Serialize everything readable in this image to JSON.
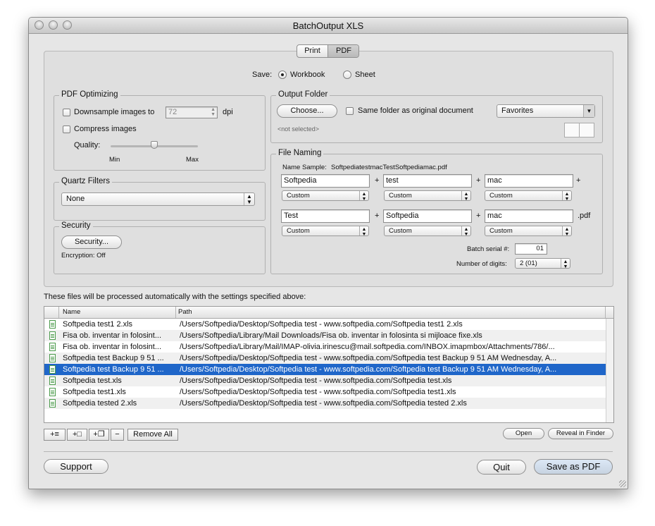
{
  "window": {
    "title": "BatchOutput XLS"
  },
  "segment": {
    "print": "Print",
    "pdf": "PDF",
    "selected": "PDF"
  },
  "save": {
    "label": "Save:",
    "workbook": "Workbook",
    "sheet": "Sheet",
    "selected": "Workbook"
  },
  "pdf_optimizing": {
    "legend": "PDF Optimizing",
    "downsample_label": "Downsample images to",
    "downsample_checked": false,
    "dpi_value": "72",
    "dpi_unit": "dpi",
    "compress_label": "Compress images",
    "compress_checked": false,
    "quality_label": "Quality:",
    "min_label": "Min",
    "max_label": "Max",
    "quality_level": 0.5
  },
  "quartz": {
    "legend": "Quartz Filters",
    "selected": "None"
  },
  "security": {
    "legend": "Security",
    "button": "Security...",
    "encryption": "Encryption: Off"
  },
  "output_folder": {
    "legend": "Output Folder",
    "choose_button": "Choose...",
    "same_folder_label": "Same folder as original document",
    "same_folder_checked": false,
    "favorites": "Favorites",
    "not_selected": "<not selected>"
  },
  "file_naming": {
    "legend": "File Naming",
    "sample_label": "Name Sample:",
    "sample_value": "SoftpediatestmacTestSoftpediamac.pdf",
    "row1": [
      {
        "value": "Softpedia",
        "popup": "Custom",
        "sep": "+"
      },
      {
        "value": "test",
        "popup": "Custom",
        "sep": "+"
      },
      {
        "value": "mac",
        "popup": "Custom",
        "sep": "+"
      }
    ],
    "row2": [
      {
        "value": "Test",
        "popup": "Custom",
        "sep": "+"
      },
      {
        "value": "Softpedia",
        "popup": "Custom",
        "sep": "+"
      },
      {
        "value": "mac",
        "popup": "Custom",
        "sep": ".pdf"
      }
    ],
    "batch_serial_label": "Batch serial #:",
    "batch_serial_value": "01",
    "digits_label": "Number of digits:",
    "digits_value": "2 (01)"
  },
  "files": {
    "caption": "These files will be processed automatically with the settings specified above:",
    "col_name": "Name",
    "col_path": "Path",
    "rows": [
      {
        "name": "Softpedia test1 2.xls",
        "path": "/Users/Softpedia/Desktop/Softpedia test - www.softpedia.com/Softpedia test1 2.xls",
        "selected": false
      },
      {
        "name": "Fisa ob. inventar in folosint...",
        "path": "/Users/Softpedia/Library/Mail Downloads/Fisa ob. inventar in folosinta si mijloace fixe.xls",
        "selected": false
      },
      {
        "name": "Fisa ob. inventar in folosint...",
        "path": "/Users/Softpedia/Library/Mail/IMAP-olivia.irinescu@mail.softpedia.com/INBOX.imapmbox/Attachments/786/...",
        "selected": false
      },
      {
        "name": "Softpedia test Backup 9 51 ...",
        "path": "/Users/Softpedia/Desktop/Softpedia test - www.softpedia.com/Softpedia test Backup 9 51 AM Wednesday, A...",
        "selected": false
      },
      {
        "name": "Softpedia test Backup 9 51 ...",
        "path": "/Users/Softpedia/Desktop/Softpedia test - www.softpedia.com/Softpedia test Backup 9 51 AM Wednesday, A...",
        "selected": true
      },
      {
        "name": "Softpedia test.xls",
        "path": "/Users/Softpedia/Desktop/Softpedia test - www.softpedia.com/Softpedia test.xls",
        "selected": false
      },
      {
        "name": "Softpedia test1.xls",
        "path": "/Users/Softpedia/Desktop/Softpedia test - www.softpedia.com/Softpedia test1.xls",
        "selected": false
      },
      {
        "name": "Softpedia tested 2.xls",
        "path": "/Users/Softpedia/Desktop/Softpedia test - www.softpedia.com/Softpedia tested 2.xls",
        "selected": false
      }
    ]
  },
  "list_tools": {
    "add_list": "+≡",
    "add_file": "+□",
    "add_folder": "+❐",
    "remove": "−",
    "remove_all": "Remove All"
  },
  "open_button": "Open",
  "reveal_button": "Reveal in Finder",
  "support_button": "Support",
  "quit_button": "Quit",
  "save_pdf_button": "Save as PDF",
  "colors": {
    "selection": "#1f66c9",
    "window_bg": "#e6e6e6"
  }
}
